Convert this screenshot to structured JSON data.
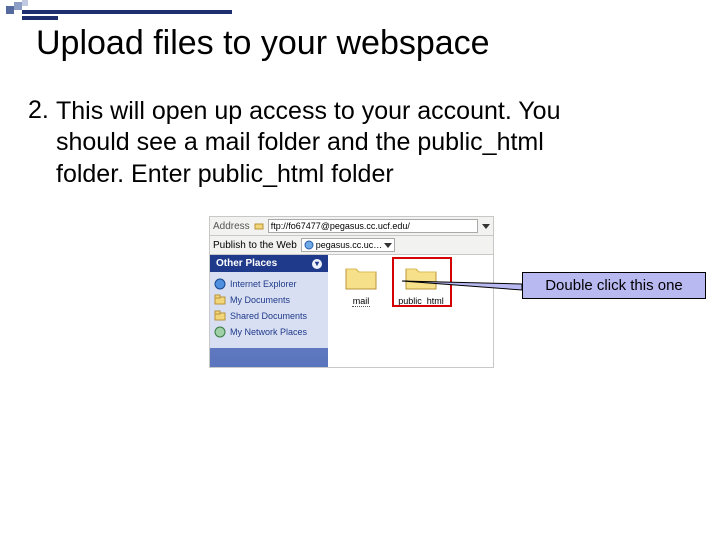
{
  "title": "Upload files to your webspace",
  "step_number": "2.",
  "step_text": "This will open up access to your account. You should see a mail folder and the public_html folder. Enter public_html folder",
  "explorer": {
    "address_label": "Address",
    "address_value": "ftp://fo67477@pegasus.cc.ucf.edu/",
    "toolbar_label": "Publish to the Web",
    "toolbar_dropdown": "pegasus.cc.uc…",
    "sidebar_header": "Other Places",
    "sidebar_items": [
      "Internet Explorer",
      "My Documents",
      "Shared Documents",
      "My Network Places"
    ],
    "folders": {
      "mail": "mail",
      "public_html": "public_html"
    }
  },
  "callout": "Double click this one"
}
